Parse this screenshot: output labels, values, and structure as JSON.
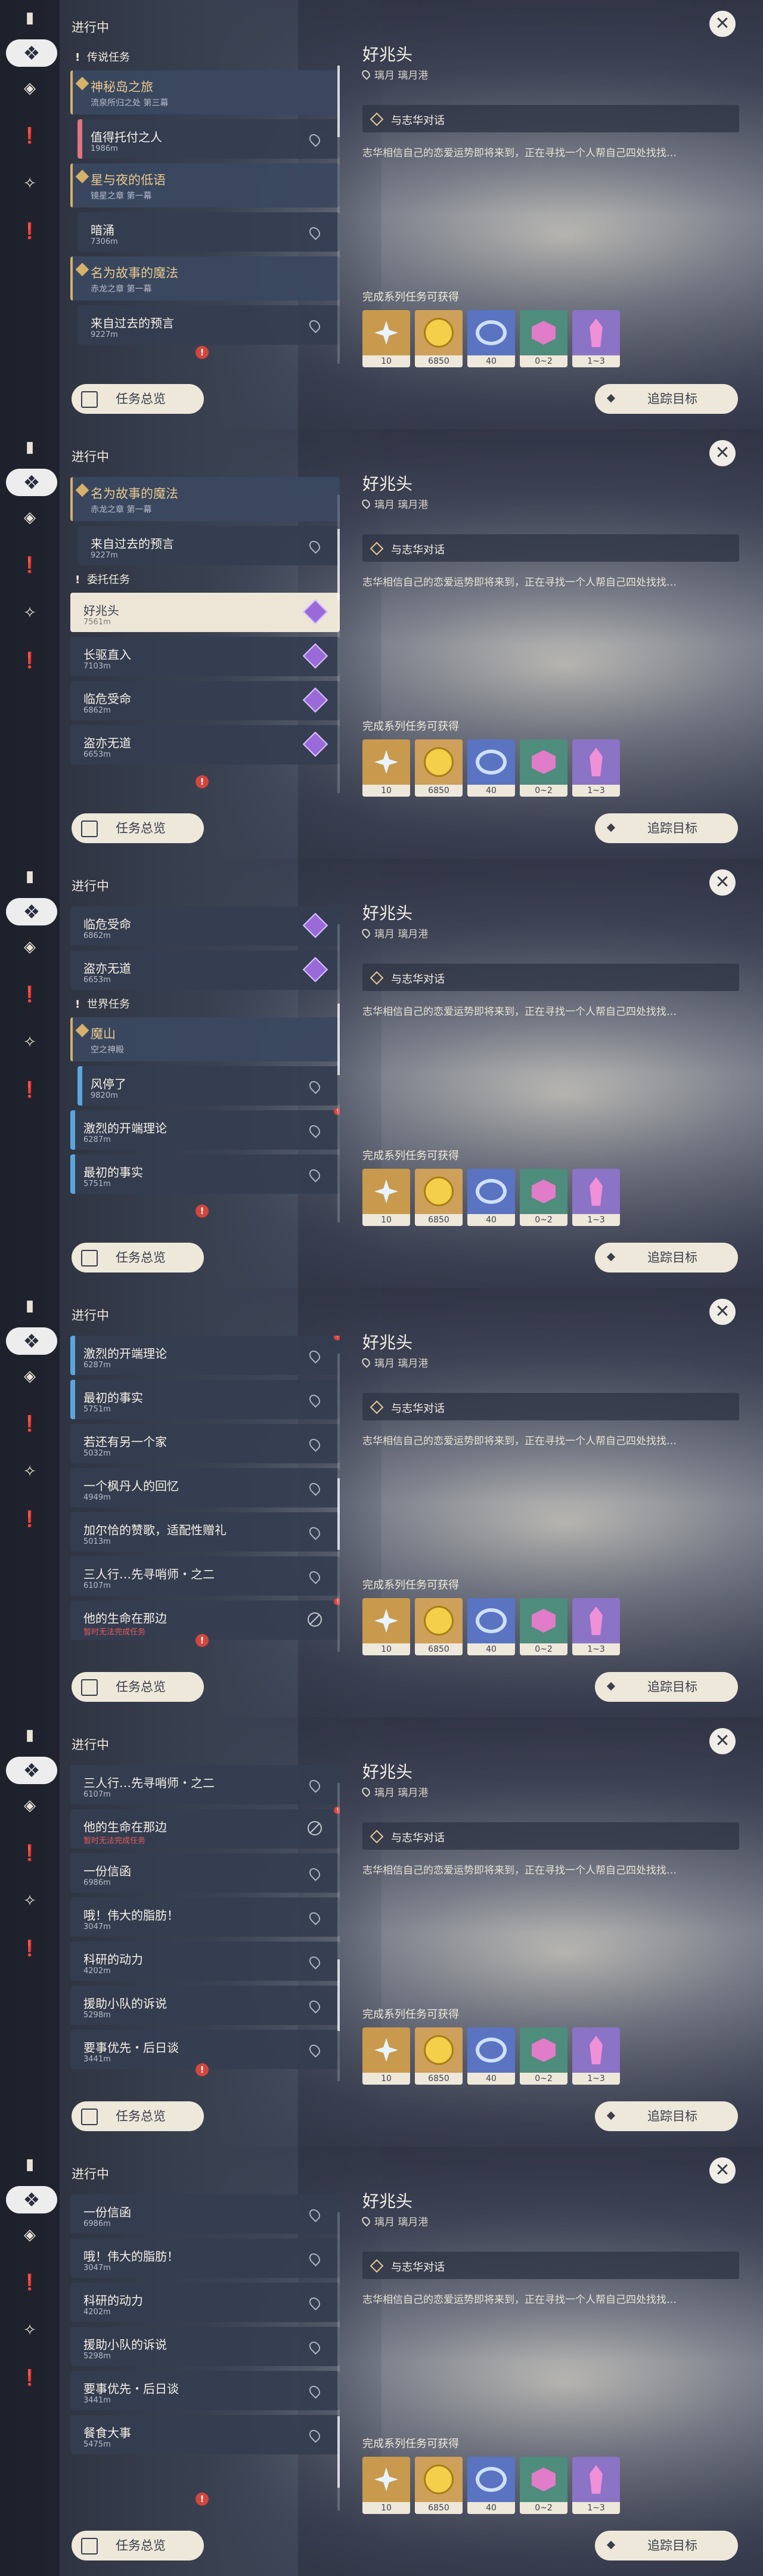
{
  "header": "进行中",
  "close_icon": "close-icon",
  "overview_label": "任务总览",
  "track_label": "追踪目标",
  "detail": {
    "title": "好兆头",
    "location": "璃月 璃月港",
    "objective": "与志华对话",
    "description": "志华相信自己的恋爱运势即将来到，正在寻找一个人帮自己四处找找…",
    "rewards_heading": "完成系列任务可获得",
    "rewards": [
      {
        "icon": "adventure-exp-icon",
        "count": "10",
        "kind": "star",
        "bg": "#c99a4d"
      },
      {
        "icon": "mora-icon",
        "count": "6850",
        "kind": "coin",
        "bg": "#cfa05a"
      },
      {
        "icon": "fetters-icon",
        "count": "40",
        "kind": "ring",
        "bg": "#5a74c2"
      },
      {
        "icon": "ore-icon",
        "count": "0~2",
        "kind": "hex",
        "bg": "#4e8c7c"
      },
      {
        "icon": "crystal-icon",
        "count": "1~3",
        "kind": "crys",
        "bg": "#8b73c6"
      }
    ]
  },
  "frames": [
    {
      "scroll_pos": 0.0,
      "rows": [
        {
          "type": "cat",
          "title": "传说任务"
        },
        {
          "type": "group",
          "title": "神秘岛之旅",
          "sub": "流泉所归之处 第三幕"
        },
        {
          "type": "row",
          "title": "值得托付之人",
          "dist": "1986m",
          "stripe": "#e07480",
          "icon": "pin",
          "sub": true
        },
        {
          "type": "group",
          "title": "星与夜的低语",
          "sub": "镜星之章 第一幕"
        },
        {
          "type": "row",
          "title": "暗涌",
          "dist": "7306m",
          "icon": "pin",
          "sub": true
        },
        {
          "type": "group",
          "title": "名为故事的魔法",
          "sub": "赤龙之章 第一幕"
        },
        {
          "type": "row",
          "title": "来自过去的预言",
          "dist": "9227m",
          "icon": "pin",
          "sub": true
        }
      ]
    },
    {
      "scroll_pos": 0.15,
      "rows": [
        {
          "type": "group",
          "title": "名为故事的魔法",
          "sub": "赤龙之章 第一幕"
        },
        {
          "type": "row",
          "title": "来自过去的预言",
          "dist": "9227m",
          "icon": "pin",
          "sub": true
        },
        {
          "type": "cat",
          "title": "委托任务"
        },
        {
          "type": "row",
          "title": "好兆头",
          "dist": "7561m",
          "icon": "gem",
          "sel": true
        },
        {
          "type": "row",
          "title": "长驱直入",
          "dist": "7103m",
          "icon": "gem"
        },
        {
          "type": "row",
          "title": "临危受命",
          "dist": "6862m",
          "icon": "gem"
        },
        {
          "type": "row",
          "title": "盗亦无道",
          "dist": "6653m",
          "icon": "gem"
        }
      ]
    },
    {
      "scroll_pos": 0.35,
      "rows": [
        {
          "type": "row",
          "title": "临危受命",
          "dist": "6862m",
          "icon": "gem"
        },
        {
          "type": "row",
          "title": "盗亦无道",
          "dist": "6653m",
          "icon": "gem"
        },
        {
          "type": "cat",
          "title": "世界任务"
        },
        {
          "type": "group",
          "title": "魔山",
          "sub": "空之神殿"
        },
        {
          "type": "row",
          "title": "风停了",
          "dist": "9820m",
          "stripe": "#5aa7e0",
          "icon": "pin",
          "sub": true
        },
        {
          "type": "row",
          "title": "激烈的开端理论",
          "dist": "6287m",
          "stripe": "#5aa7e0",
          "icon": "pin",
          "badge": true
        },
        {
          "type": "row",
          "title": "最初的事实",
          "dist": "5751m",
          "stripe": "#5aa7e0",
          "icon": "pin"
        }
      ]
    },
    {
      "scroll_pos": 0.55,
      "rows": [
        {
          "type": "row",
          "title": "激烈的开端理论",
          "dist": "6287m",
          "stripe": "#5aa7e0",
          "icon": "pin",
          "badge": true
        },
        {
          "type": "row",
          "title": "最初的事实",
          "dist": "5751m",
          "stripe": "#5aa7e0",
          "icon": "pin"
        },
        {
          "type": "row",
          "title": "若还有另一个家",
          "dist": "5032m",
          "icon": "pin"
        },
        {
          "type": "row",
          "title": "一个枫丹人的回忆",
          "dist": "4949m",
          "icon": "pin"
        },
        {
          "type": "row",
          "title": "加尔恰的赞歌，适配性赠礼",
          "dist": "5013m",
          "icon": "pin"
        },
        {
          "type": "row",
          "title": "三人行…先寻哨师・之二",
          "dist": "6107m",
          "icon": "pin"
        },
        {
          "type": "row",
          "title": "他的生命在那边",
          "dist": "暂时无法完成任务",
          "red": true,
          "icon": "ban",
          "badge": true
        }
      ]
    },
    {
      "scroll_pos": 0.78,
      "rows": [
        {
          "type": "row",
          "title": "三人行…先寻哨师・之二",
          "dist": "6107m",
          "icon": "pin"
        },
        {
          "type": "row",
          "title": "他的生命在那边",
          "dist": "暂时无法完成任务",
          "red": true,
          "icon": "ban",
          "badge": true
        },
        {
          "type": "row",
          "title": "一份信函",
          "dist": "6986m",
          "icon": "pin"
        },
        {
          "type": "row",
          "title": "哦！伟大的脂肪！",
          "dist": "3047m",
          "icon": "pin"
        },
        {
          "type": "row",
          "title": "科研的动力",
          "dist": "4202m",
          "icon": "pin"
        },
        {
          "type": "row",
          "title": "援助小队的诉说",
          "dist": "5298m",
          "icon": "pin"
        },
        {
          "type": "row",
          "title": "要事优先・后日谈",
          "dist": "3441m",
          "icon": "pin"
        }
      ]
    },
    {
      "scroll_pos": 0.9,
      "rows": [
        {
          "type": "row",
          "title": "一份信函",
          "dist": "6986m",
          "icon": "pin"
        },
        {
          "type": "row",
          "title": "哦！伟大的脂肪！",
          "dist": "3047m",
          "icon": "pin"
        },
        {
          "type": "row",
          "title": "科研的动力",
          "dist": "4202m",
          "icon": "pin"
        },
        {
          "type": "row",
          "title": "援助小队的诉说",
          "dist": "5298m",
          "icon": "pin"
        },
        {
          "type": "row",
          "title": "要事优先・后日谈",
          "dist": "3441m",
          "icon": "pin"
        },
        {
          "type": "row",
          "title": "餐食大事",
          "dist": "5475m",
          "icon": "pin"
        }
      ]
    }
  ],
  "rail_icons": [
    "quest-book-icon",
    "all-quests-icon",
    "archon-quest-icon",
    "story-quest-icon",
    "commission-icon",
    "world-quest-icon"
  ]
}
